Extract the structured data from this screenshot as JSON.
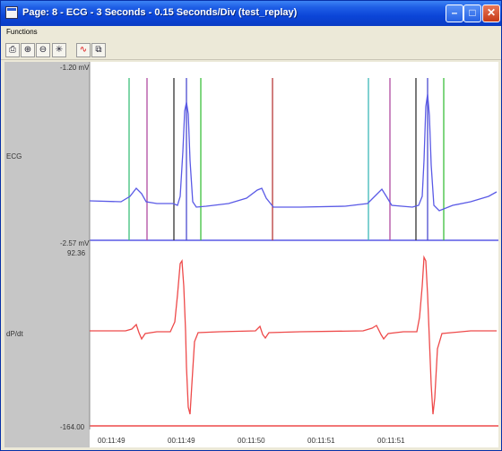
{
  "window": {
    "title": "Page: 8 - ECG - 3 Seconds - 0.15 Seconds/Div (test_replay)",
    "minimize_glyph": "–",
    "maximize_glyph": "□",
    "close_glyph": "✕"
  },
  "menu": {
    "items": [
      "Functions"
    ]
  },
  "toolbar": {
    "buttons": [
      {
        "name": "print-icon",
        "glyph": "⎙"
      },
      {
        "name": "zoom-in-icon",
        "glyph": "⊕"
      },
      {
        "name": "zoom-out-icon",
        "glyph": "⊖"
      },
      {
        "name": "reset-icon",
        "glyph": "✳"
      },
      {
        "name": "waveform-icon",
        "glyph": "∿"
      },
      {
        "name": "copy-icon",
        "glyph": "⧉"
      }
    ]
  },
  "channels": {
    "ecg": {
      "label": "ECG",
      "top_value": "-1.20 mV",
      "bottom_value": "-2.57 mV",
      "color": "#5a5ae6"
    },
    "dpm": {
      "label": "dP/dt",
      "top_value": "92.36",
      "bottom_value": "-164.00",
      "color": "#ee4a4a"
    }
  },
  "time_axis": {
    "ticks": [
      "00:11:49",
      "00:11:49",
      "00:11:50",
      "00:11:51",
      "00:11:51"
    ]
  },
  "markers": [
    {
      "color": "#3cbf7a"
    },
    {
      "color": "#b04aa0"
    },
    {
      "color": "#333333"
    },
    {
      "color": "#4a4ad0"
    },
    {
      "color": "#3cbf3c"
    },
    {
      "color": "#b83a3a"
    },
    {
      "color": "#3cb8b8"
    },
    {
      "color": "#b04aa0"
    },
    {
      "color": "#333333"
    },
    {
      "color": "#4a4ad0"
    },
    {
      "color": "#3cbf3c"
    }
  ]
}
